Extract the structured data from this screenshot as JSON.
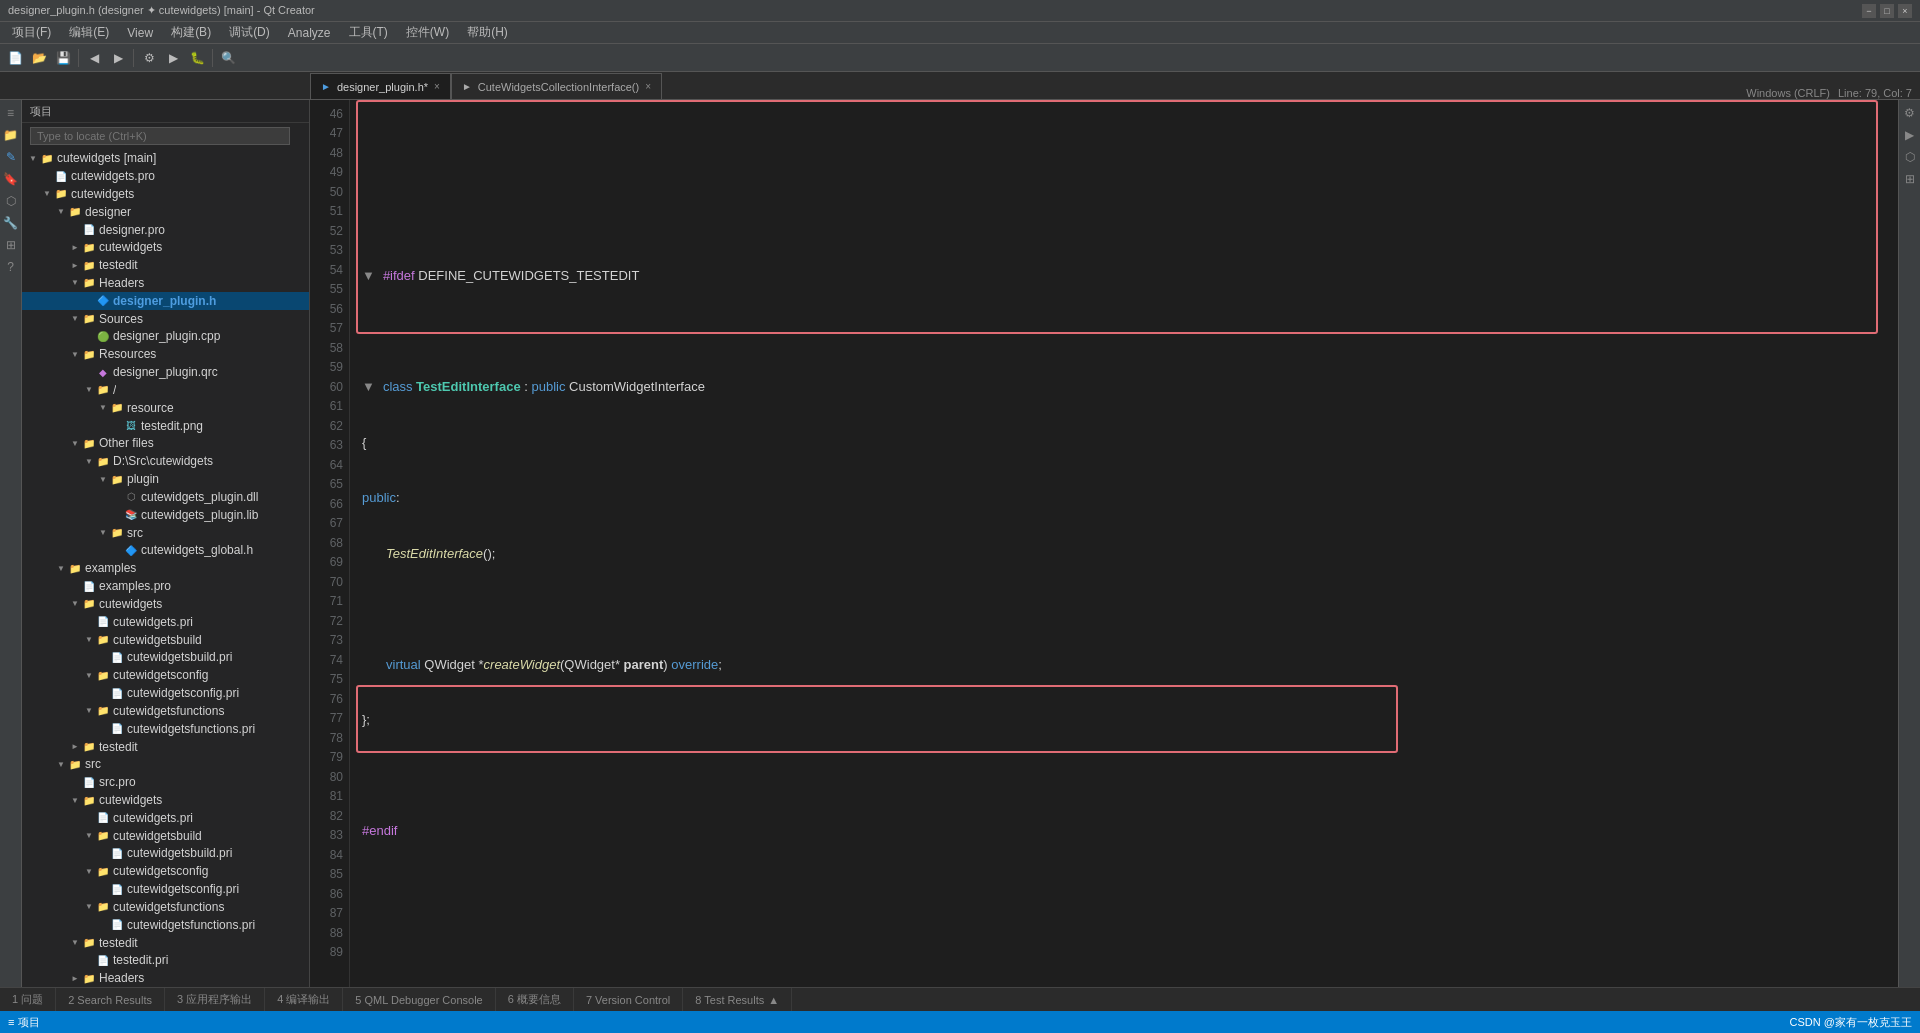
{
  "titleBar": {
    "title": "designer_plugin.h (designer ✦ cutewidgets) [main] - Qt Creator",
    "controls": [
      "−",
      "□",
      "×"
    ]
  },
  "menuBar": {
    "items": [
      "项目(F)",
      "编辑(E)",
      "View",
      "构建(B)",
      "调试(D)",
      "Analyze",
      "工具(T)",
      "控件(W)",
      "帮助(H)"
    ]
  },
  "tabBar": {
    "leftTab": {
      "icon": "►",
      "label": "designer_plugin.h*",
      "modified": true
    },
    "rightTab": {
      "icon": "►",
      "label": "CuteWidgetsCollectionInterface()"
    },
    "statusRight": "Windows (CRLF)    Line: 79, Col: 7"
  },
  "fileTree": {
    "searchPlaceholder": "Type to locate (Ctrl+K)",
    "items": [
      {
        "label": "cutewidgets [main]",
        "indent": 0,
        "type": "folder",
        "expanded": true,
        "arrow": "▼"
      },
      {
        "label": "cutewidgets.pro",
        "indent": 1,
        "type": "file-pro"
      },
      {
        "label": "cutewidgets",
        "indent": 1,
        "type": "folder",
        "expanded": true,
        "arrow": "▼"
      },
      {
        "label": "designer",
        "indent": 2,
        "type": "folder",
        "expanded": true,
        "arrow": "▼"
      },
      {
        "label": "designer.pro",
        "indent": 3,
        "type": "file-pro"
      },
      {
        "label": "cutewidgets",
        "indent": 3,
        "type": "folder",
        "expanded": false,
        "arrow": "►"
      },
      {
        "label": "testedit",
        "indent": 3,
        "type": "folder",
        "expanded": false,
        "arrow": "►"
      },
      {
        "label": "Headers",
        "indent": 3,
        "type": "folder",
        "expanded": true,
        "arrow": "▼"
      },
      {
        "label": "designer_plugin.h",
        "indent": 4,
        "type": "file-h",
        "selected": true
      },
      {
        "label": "Sources",
        "indent": 3,
        "type": "folder",
        "expanded": true,
        "arrow": "▼"
      },
      {
        "label": "designer_plugin.cpp",
        "indent": 4,
        "type": "file-cpp"
      },
      {
        "label": "Resources",
        "indent": 3,
        "type": "folder",
        "expanded": true,
        "arrow": "▼"
      },
      {
        "label": "designer_plugin.qrc",
        "indent": 4,
        "type": "file-qrc"
      },
      {
        "label": "/",
        "indent": 4,
        "type": "folder",
        "expanded": true,
        "arrow": "▼"
      },
      {
        "label": "resource",
        "indent": 5,
        "type": "folder",
        "expanded": true,
        "arrow": "▼"
      },
      {
        "label": "testedit.png",
        "indent": 6,
        "type": "file-png"
      },
      {
        "label": "Other files",
        "indent": 3,
        "type": "folder",
        "expanded": true,
        "arrow": "▼"
      },
      {
        "label": "D:\\Src\\cutewidgets",
        "indent": 4,
        "type": "folder",
        "expanded": true,
        "arrow": "▼"
      },
      {
        "label": "plugin",
        "indent": 5,
        "type": "folder",
        "expanded": true,
        "arrow": "▼"
      },
      {
        "label": "cutewidgets_plugin.dll",
        "indent": 6,
        "type": "file-dll"
      },
      {
        "label": "cutewidgets_plugin.lib",
        "indent": 6,
        "type": "file-lib"
      },
      {
        "label": "src",
        "indent": 5,
        "type": "folder",
        "expanded": true,
        "arrow": "▼"
      },
      {
        "label": "cutewidgets_global.h",
        "indent": 6,
        "type": "file-h"
      },
      {
        "label": "examples",
        "indent": 2,
        "type": "folder",
        "expanded": true,
        "arrow": "▼"
      },
      {
        "label": "examples.pro",
        "indent": 3,
        "type": "file-pro"
      },
      {
        "label": "cutewidgets",
        "indent": 3,
        "type": "folder",
        "expanded": true,
        "arrow": "▼"
      },
      {
        "label": "cutewidgets.pri",
        "indent": 4,
        "type": "file-pri"
      },
      {
        "label": "cutewidgetsbuild",
        "indent": 4,
        "type": "folder",
        "expanded": true,
        "arrow": "▼"
      },
      {
        "label": "cutewidgetsbuild.pri",
        "indent": 5,
        "type": "file-pri"
      },
      {
        "label": "cutewidgetsconfig",
        "indent": 4,
        "type": "folder",
        "expanded": true,
        "arrow": "▼"
      },
      {
        "label": "cutewidgetsconfig.pri",
        "indent": 5,
        "type": "file-pri"
      },
      {
        "label": "cutewidgetsfunctions",
        "indent": 4,
        "type": "folder",
        "expanded": true,
        "arrow": "▼"
      },
      {
        "label": "cutewidgetsfunctions.pri",
        "indent": 5,
        "type": "file-pri"
      },
      {
        "label": "testedit",
        "indent": 3,
        "type": "folder",
        "expanded": false,
        "arrow": "►"
      },
      {
        "label": "src",
        "indent": 2,
        "type": "folder",
        "expanded": true,
        "arrow": "▼"
      },
      {
        "label": "src.pro",
        "indent": 3,
        "type": "file-pro"
      },
      {
        "label": "cutewidgets",
        "indent": 3,
        "type": "folder",
        "expanded": true,
        "arrow": "▼"
      },
      {
        "label": "cutewidgets.pri",
        "indent": 4,
        "type": "file-pri"
      },
      {
        "label": "cutewidgetsbuild",
        "indent": 4,
        "type": "folder",
        "expanded": true,
        "arrow": "▼"
      },
      {
        "label": "cutewidgetsbuild.pri",
        "indent": 5,
        "type": "file-pri"
      },
      {
        "label": "cutewidgetsconfig",
        "indent": 4,
        "type": "folder",
        "expanded": true,
        "arrow": "▼"
      },
      {
        "label": "cutewidgetsconfig.pri",
        "indent": 5,
        "type": "file-pri"
      },
      {
        "label": "cutewidgetsfunctions",
        "indent": 4,
        "type": "folder",
        "expanded": true,
        "arrow": "▼"
      },
      {
        "label": "cutewidgetsfunctions.pri",
        "indent": 5,
        "type": "file-pri"
      },
      {
        "label": "testedit",
        "indent": 3,
        "type": "folder",
        "expanded": true,
        "arrow": "▼"
      },
      {
        "label": "testedit.pri",
        "indent": 4,
        "type": "file-pri"
      },
      {
        "label": "Headers",
        "indent": 3,
        "type": "folder",
        "expanded": false,
        "arrow": "►"
      }
    ]
  },
  "editor": {
    "filename": "designer_plugin.h*"
  },
  "bottomTabs": [
    {
      "label": "1 问题",
      "badge": null,
      "active": false
    },
    {
      "label": "2 Search Results",
      "badge": null,
      "active": false
    },
    {
      "label": "3 应用程序输出",
      "badge": null,
      "active": false
    },
    {
      "label": "4 编译输出",
      "badge": null,
      "active": false
    },
    {
      "label": "5 QML Debugger Console",
      "badge": null,
      "active": false
    },
    {
      "label": "6 概要信息",
      "badge": null,
      "active": false
    },
    {
      "label": "7 Version Control",
      "badge": null,
      "active": false
    },
    {
      "label": "8 Test Results",
      "badge": null,
      "active": false
    }
  ],
  "statusBar": {
    "left": "项目",
    "right": "CSDN @家有一枚克玉王"
  }
}
